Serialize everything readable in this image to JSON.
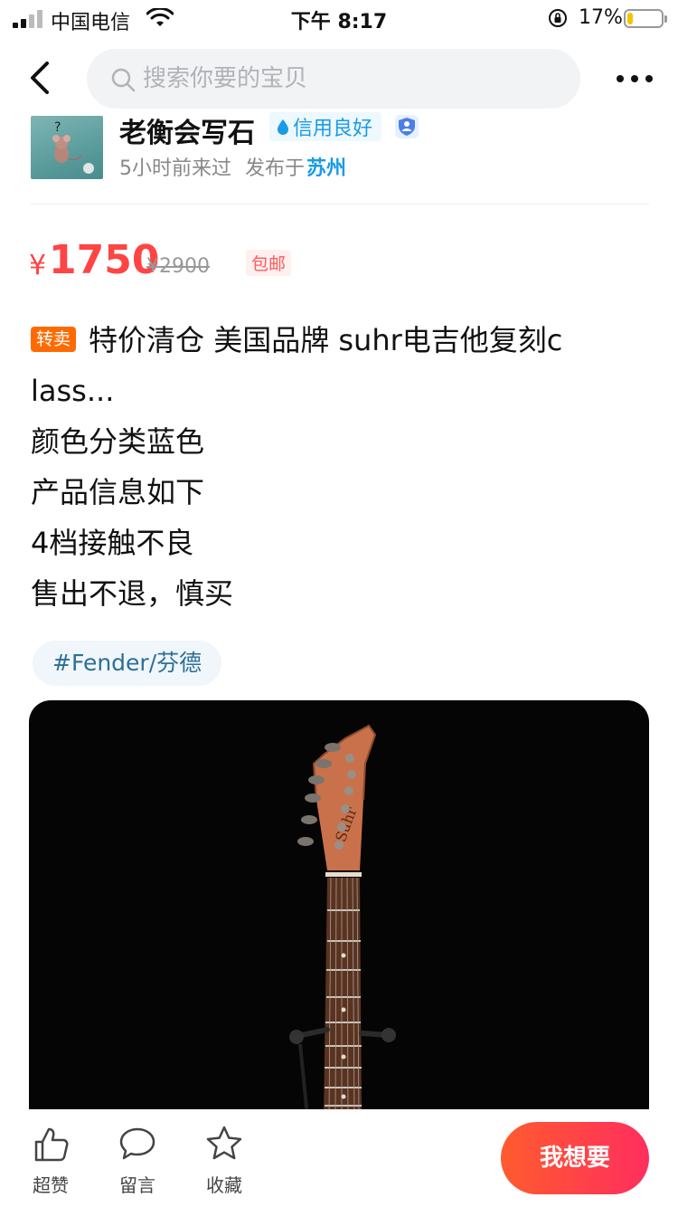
{
  "status_bar": {
    "carrier": "中国电信",
    "time": "下午 8:17",
    "battery_percent": "17%",
    "battery_level": 0.17,
    "icons": [
      "signal-icon",
      "wifi-icon",
      "orientation-lock-icon",
      "battery-icon"
    ]
  },
  "nav": {
    "back_icon": "chevron-left-icon",
    "search_placeholder": "搜索你要的宝贝",
    "more_icon": "more-dots-icon"
  },
  "seller": {
    "name": "老衡会写石",
    "credit_badge": "信用良好",
    "last_seen": "5小时前来过",
    "published_in_label": "发布于",
    "city": "苏州"
  },
  "listing": {
    "currency": "¥",
    "price": "1750",
    "original_price": "¥2900",
    "shipping_tag": "包邮",
    "resell_tag": "转卖",
    "title_line1": "特价清仓 美国品牌 suhr电吉他复刻c",
    "title_line2": "lass...",
    "desc_lines": [
      "颜色分类蓝色",
      "产品信息如下",
      "4档接触不良",
      "售出不退，慎买"
    ],
    "topic_tag": "#Fender/芬德"
  },
  "bottom_bar": {
    "like_label": "超赞",
    "comment_label": "留言",
    "favorite_label": "收藏",
    "want_button": "我想要"
  },
  "colors": {
    "price_red": "#ff4444",
    "credit_blue": "#1a9be6",
    "resell_orange": "#ff6a00",
    "want_gradient_start": "#ff5b2e",
    "want_gradient_end": "#ff2e5e"
  }
}
